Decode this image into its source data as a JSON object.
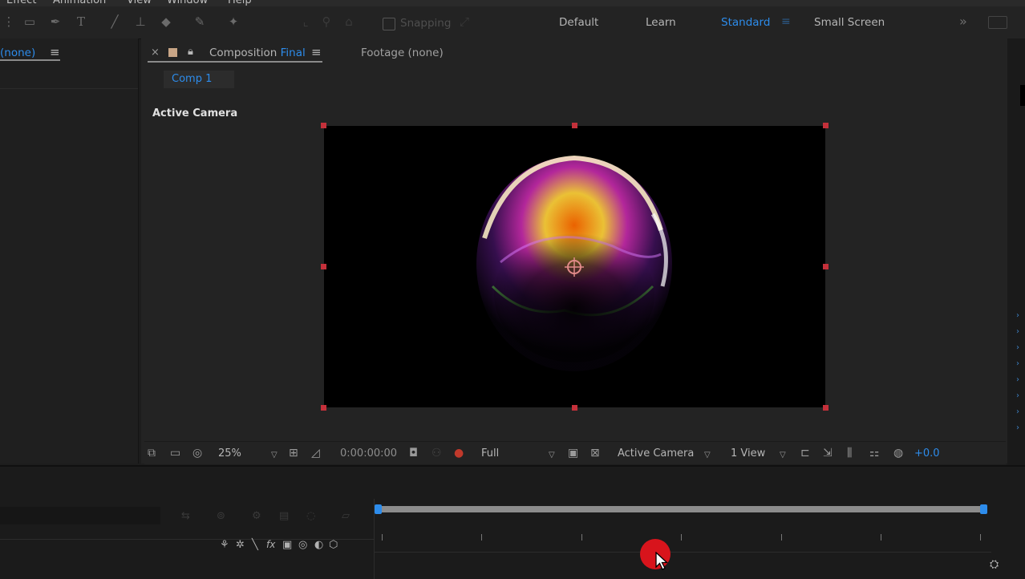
{
  "menu": {
    "items": [
      "Effect",
      "Animation",
      "View",
      "Window",
      "Help"
    ]
  },
  "toolbar": {
    "snapping_label": "Snapping",
    "workspaces": [
      "Default",
      "Learn",
      "Standard",
      "Small Screen"
    ],
    "active_workspace": "Standard"
  },
  "project_panel": {
    "tab_label": "(none)"
  },
  "comp_panel": {
    "tab_prefix": "Composition",
    "tab_name": "Final",
    "footage_tab": "Footage (none)",
    "breadcrumb": "Comp 1",
    "view_label": "Active Camera"
  },
  "viewer_bar": {
    "zoom": "25%",
    "timecode": "0:00:00:00",
    "resolution": "Full",
    "camera": "Active Camera",
    "views": "1 View",
    "exposure": "+0.0"
  },
  "colors": {
    "accent": "#2d8ceb",
    "handle": "#c4303a",
    "cursor_dot": "#d8141c"
  }
}
